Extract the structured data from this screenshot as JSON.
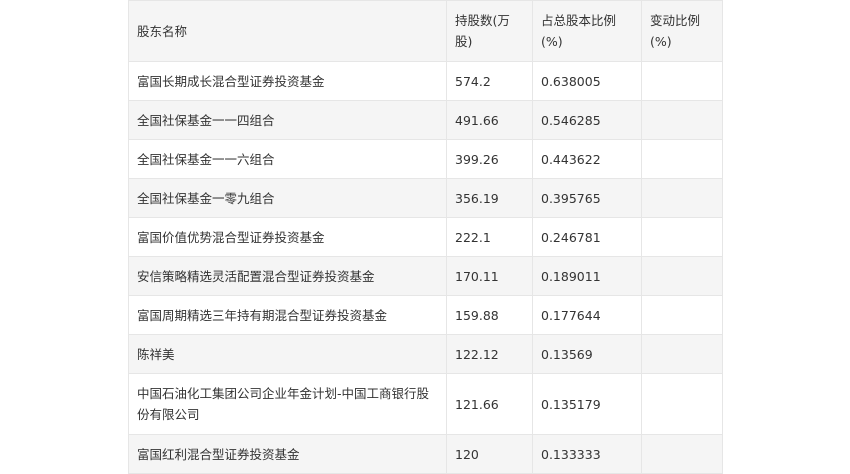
{
  "table": {
    "headers": {
      "name": "股东名称",
      "shares": "持股数(万股)",
      "ratio": "占总股本比例(%)",
      "change": "变动比例(%)"
    },
    "rows": [
      {
        "name": "富国长期成长混合型证券投资基金",
        "shares": "574.2",
        "ratio": "0.638005",
        "change": ""
      },
      {
        "name": "全国社保基金一一四组合",
        "shares": "491.66",
        "ratio": "0.546285",
        "change": ""
      },
      {
        "name": "全国社保基金一一六组合",
        "shares": "399.26",
        "ratio": "0.443622",
        "change": ""
      },
      {
        "name": "全国社保基金一零九组合",
        "shares": "356.19",
        "ratio": "0.395765",
        "change": ""
      },
      {
        "name": "富国价值优势混合型证券投资基金",
        "shares": "222.1",
        "ratio": "0.246781",
        "change": ""
      },
      {
        "name": "安信策略精选灵活配置混合型证券投资基金",
        "shares": "170.11",
        "ratio": "0.189011",
        "change": ""
      },
      {
        "name": "富国周期精选三年持有期混合型证券投资基金",
        "shares": "159.88",
        "ratio": "0.177644",
        "change": ""
      },
      {
        "name": "陈祥美",
        "shares": "122.12",
        "ratio": "0.13569",
        "change": ""
      },
      {
        "name": "中国石油化工集团公司企业年金计划-中国工商银行股份有限公司",
        "shares": "121.66",
        "ratio": "0.135179",
        "change": ""
      },
      {
        "name": "富国红利混合型证券投资基金",
        "shares": "120",
        "ratio": "0.133333",
        "change": ""
      }
    ]
  }
}
